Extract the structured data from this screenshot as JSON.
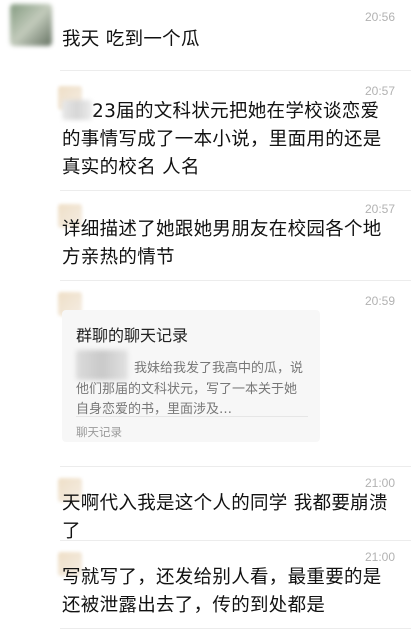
{
  "colors": {
    "timestamp": "#b2b2b2",
    "text": "#111111",
    "card_bg": "#f7f7f7",
    "divider": "#ececec"
  },
  "messages": [
    {
      "time": "20:56",
      "text": "我天 吃到一个瓜"
    },
    {
      "time": "20:57",
      "text_after_redaction": "23届的文科状元把她在学校谈恋爱的事情写成了一本小说，里面用的还是真实的校名 人名"
    },
    {
      "time": "20:57",
      "text": "详细描述了她跟她男朋友在校园各个地方亲热的情节"
    },
    {
      "time": "20:59",
      "card": {
        "title": "群聊的聊天记录",
        "preview": "我妹给我发了我高中的瓜，说他们那届的文科状元，写了一本关于她自身恋爱的书，里面涉及…",
        "footer": "聊天记录"
      }
    },
    {
      "time": "21:00",
      "text": "天啊代入我是这个人的同学 我都要崩溃了"
    },
    {
      "time": "21:00",
      "text": "写就写了，还发给别人看，最重要的是还被泄露出去了，传的到处都是"
    }
  ],
  "icons": {
    "avatar": "blurred-avatar-icon"
  }
}
